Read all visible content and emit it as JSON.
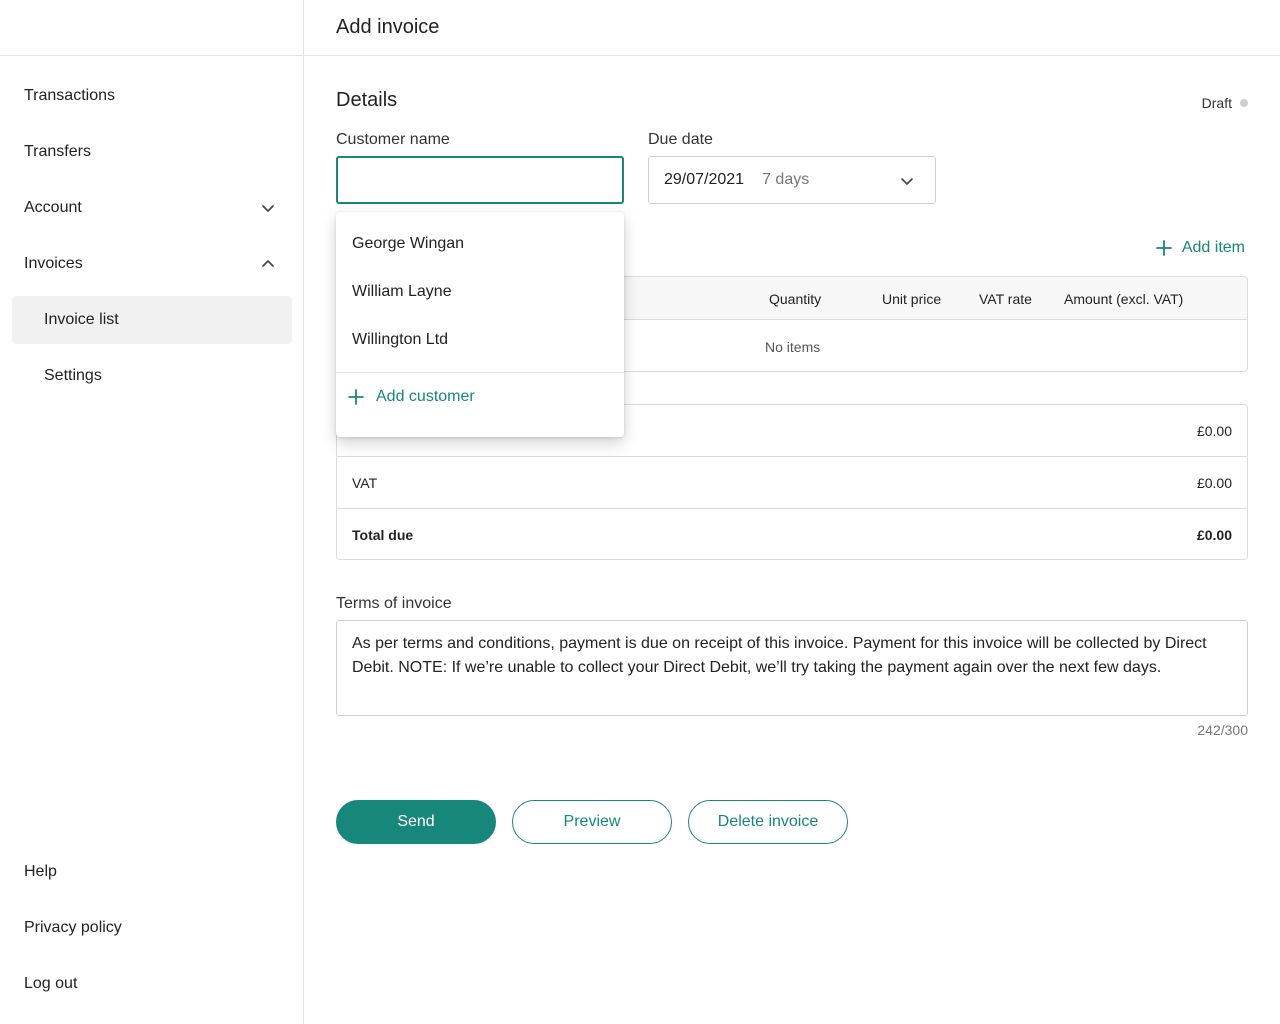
{
  "sidebar": {
    "items": [
      {
        "label": "Transactions"
      },
      {
        "label": "Transfers"
      },
      {
        "label": "Account"
      },
      {
        "label": "Invoices"
      },
      {
        "label": "Invoice list"
      },
      {
        "label": "Settings"
      }
    ],
    "footer": [
      {
        "label": "Help"
      },
      {
        "label": "Privacy policy"
      },
      {
        "label": "Log out"
      }
    ]
  },
  "header": {
    "title": "Add invoice"
  },
  "details": {
    "title": "Details",
    "status": "Draft",
    "customer_label": "Customer name",
    "customer_value": "",
    "due_label": "Due date",
    "due_date": "29/07/2021",
    "due_days": "7 days"
  },
  "customer_dropdown": {
    "options": [
      "George Wingan",
      "William Layne",
      "Willington Ltd"
    ],
    "add_label": "Add customer"
  },
  "items": {
    "add_label": "Add item",
    "columns": [
      "Quantity",
      "Unit price",
      "VAT rate",
      "Amount (excl. VAT)"
    ],
    "empty_text": "No items"
  },
  "totals": {
    "subtotal_value": "£0.00",
    "vat_label": "VAT",
    "vat_value": "£0.00",
    "total_label": "Total due",
    "total_value": "£0.00"
  },
  "terms": {
    "label": "Terms of invoice",
    "text": "As per terms and conditions, payment is due on receipt of this invoice. Payment for this invoice will be collected by Direct Debit. NOTE: If we’re unable to collect your Direct Debit, we’ll try taking the payment again over the next few days.",
    "counter": "242/300"
  },
  "actions": {
    "send": "Send",
    "preview": "Preview",
    "delete": "Delete invoice"
  },
  "colors": {
    "accent": "#17877b",
    "border": "#dcdcdc",
    "active_bg": "#f1f1f1"
  }
}
